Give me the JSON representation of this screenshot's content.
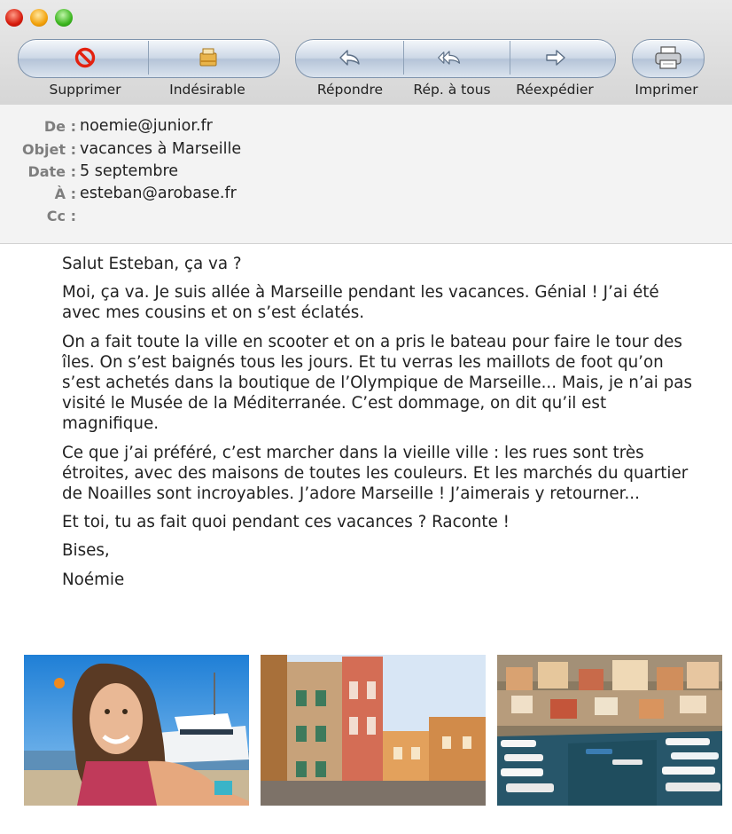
{
  "toolbar": {
    "delete_label": "Supprimer",
    "junk_label": "Indésirable",
    "reply_label": "Répondre",
    "reply_all_label": "Rép. à tous",
    "forward_label": "Réexpédier",
    "print_label": "Imprimer"
  },
  "headers": {
    "from_label": "De :",
    "from_value": "noemie@junior.fr",
    "subject_label": "Objet :",
    "subject_value": "vacances à Marseille",
    "date_label": "Date :",
    "date_value": "5 septembre",
    "to_label": "À :",
    "to_value": "esteban@arobase.fr",
    "cc_label": "Cc :",
    "cc_value": ""
  },
  "body": {
    "greeting": "Salut Esteban, ça va ?",
    "p1": "Moi, ça va. Je suis allée à Marseille pendant les vacances. Génial ! J’ai été avec mes cousins et on s’est éclatés.",
    "p2": "On a fait toute la ville en scooter et on a pris le bateau pour faire le tour des îles. On s’est baignés tous les jours. Et tu verras les maillots de foot qu’on s’est achetés dans la boutique de l’Olympique de Marseille... Mais, je n’ai pas visité le Musée de la Méditerranée. C’est dommage, on dit qu’il est magnifique.",
    "p3": "Ce que j’ai préféré, c’est marcher dans la vieille ville : les rues sont très étroites, avec des maisons de toutes les couleurs. Et les marchés du quartier de Noailles sont incroyables. J’adore Marseille ! J’aimerais y retourner...",
    "p4": "Et toi, tu as fait quoi pendant ces vacances ? Raconte !",
    "closing": "Bises,",
    "signature": "Noémie"
  },
  "colors": {
    "toolbar_bg": "#dcdcdc",
    "pill_border": "#7e93ac",
    "header_label": "#7e7e7e",
    "text": "#222222"
  },
  "icons": [
    "close-window-icon",
    "minimize-window-icon",
    "zoom-window-icon",
    "delete-icon",
    "junk-icon",
    "reply-arrow-icon",
    "reply-all-arrow-icon",
    "forward-arrow-icon",
    "printer-icon"
  ]
}
